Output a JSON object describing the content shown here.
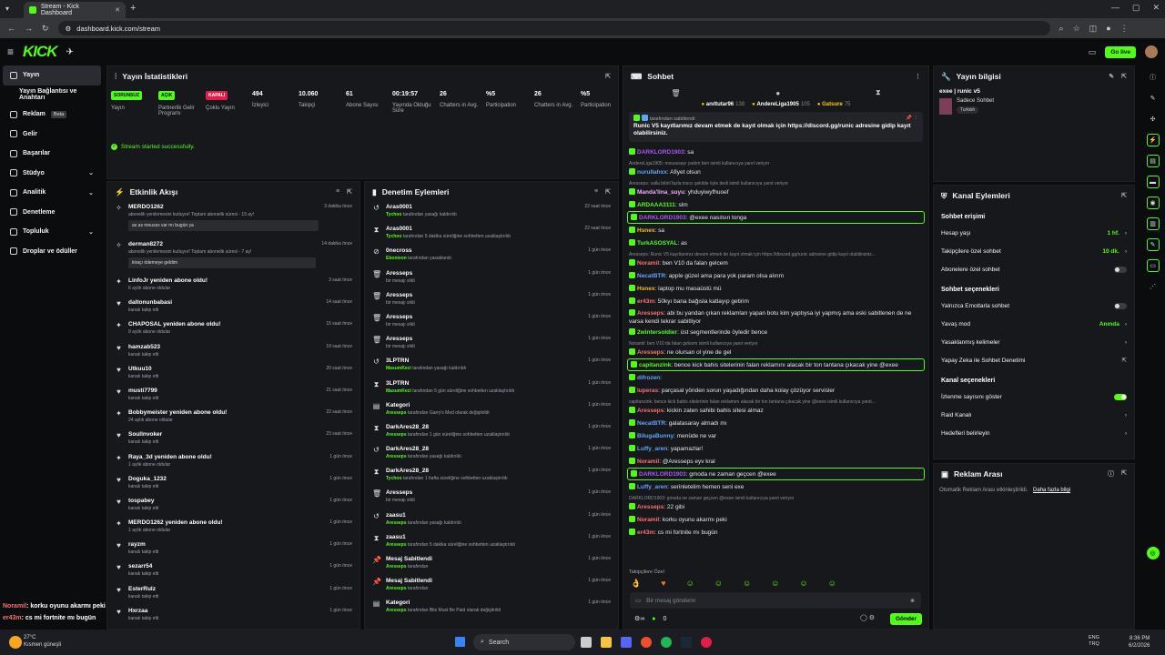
{
  "browser": {
    "tab_title": "Stream - Kick Dashboard",
    "url": "dashboard.kick.com/stream"
  },
  "topbar": {
    "go_live": "Go live"
  },
  "sidebar": {
    "items": [
      {
        "label": "Yayın",
        "icon": "video-icon",
        "active": true
      },
      {
        "label": "Yayın Bağlantısı ve Anahtarı",
        "icon": "",
        "active": false
      },
      {
        "label": "Reklam",
        "icon": "ad-icon",
        "beta": "Beta"
      },
      {
        "label": "Gelir",
        "icon": "money-icon"
      },
      {
        "label": "Başarılar",
        "icon": "trophy-icon"
      },
      {
        "label": "Stüdyo",
        "icon": "studio-icon",
        "chevron": true
      },
      {
        "label": "Analitik",
        "icon": "chart-icon",
        "chevron": true
      },
      {
        "label": "Denetleme",
        "icon": "shield-icon"
      },
      {
        "label": "Topluluk",
        "icon": "community-icon",
        "chevron": true
      },
      {
        "label": "Droplar ve ödüller",
        "icon": "gift-icon"
      }
    ]
  },
  "stats": {
    "title": "Yayın İstatistikleri",
    "success": "Stream started successfully.",
    "cols": [
      {
        "badge": "SORUNSUZ",
        "badge_color": "#53fc18",
        "label": "Yayın"
      },
      {
        "badge": "AÇIK",
        "badge_color": "#53fc18",
        "label": "Partnerlik Gelir Programı"
      },
      {
        "badge": "KAPALI",
        "badge_color": "#e11d48",
        "label": "Çoklu Yayın"
      },
      {
        "value": "494",
        "label": "İzleyici"
      },
      {
        "value": "10.060",
        "label": "Takipçi"
      },
      {
        "value": "61",
        "label": "Abone Sayısı"
      },
      {
        "value": "00:19:57",
        "label": "Yayında Olduğu Süre"
      },
      {
        "value": "26",
        "label": "Chatters in Avg."
      },
      {
        "value": "%5",
        "label": "Participation"
      },
      {
        "value": "26",
        "label": "Chatters in Avg."
      },
      {
        "value": "%5",
        "label": "Participation"
      }
    ]
  },
  "activity": {
    "title": "Etkinlik Akışı",
    "items": [
      {
        "name": "MERDO1262",
        "sub": "abonelik yenilemesini kutluyor! Toplam abonelik süresi - 15 ay!",
        "time": "3 dakika önce",
        "box": "as as mousss var mı bugün ya",
        "icon": "party"
      },
      {
        "name": "derman8272",
        "sub": "abonelik yenilemesini kutluyor! Toplam abonelik süresi - 7 ay!",
        "time": "14 dakika önce",
        "box": "kiraçı ödemeye geldim",
        "icon": "party"
      },
      {
        "name": "LinfoJr yeniden abone oldu!",
        "sub": "6 aylık abone oldular",
        "time": "3 saat önce",
        "icon": "star"
      },
      {
        "name": "daltonunbabasi",
        "sub": "kanalı takip etti",
        "time": "14 saat önce",
        "icon": "heart"
      },
      {
        "name": "CHAPOSAL yeniden abone oldu!",
        "sub": "9 aylık abone oldular",
        "time": "15 saat önce",
        "icon": "star"
      },
      {
        "name": "hamzab523",
        "sub": "kanalı takip etti",
        "time": "19 saat önce",
        "icon": "heart"
      },
      {
        "name": "Utkuu10",
        "sub": "kanalı takip etti",
        "time": "20 saat önce",
        "icon": "heart"
      },
      {
        "name": "musti7799",
        "sub": "kanalı takip etti",
        "time": "21 saat önce",
        "icon": "heart"
      },
      {
        "name": "Bobbymeister yeniden abone oldu!",
        "sub": "24 aylık abone oldular",
        "time": "22 saat önce",
        "icon": "star"
      },
      {
        "name": "Soullnvoker",
        "sub": "kanalı takip etti",
        "time": "23 saat önce",
        "icon": "heart"
      },
      {
        "name": "Raya_3d yeniden abone oldu!",
        "sub": "1 aylık abone oldular",
        "time": "1 gün önce",
        "icon": "star"
      },
      {
        "name": "Doguka_1232",
        "sub": "kanalı takip etti",
        "time": "1 gün önce",
        "icon": "heart"
      },
      {
        "name": "tospabey",
        "sub": "kanalı takip etti",
        "time": "1 gün önce",
        "icon": "heart"
      },
      {
        "name": "MERDO1262 yeniden abone oldu!",
        "sub": "1 aylık abone oldular",
        "time": "1 gün önce",
        "icon": "star"
      },
      {
        "name": "rayzm",
        "sub": "kanalı takip etti",
        "time": "1 gün önce",
        "icon": "heart"
      },
      {
        "name": "sezarr54",
        "sub": "kanalı takip etti",
        "time": "1 gün önce",
        "icon": "heart"
      },
      {
        "name": "EsterRulz",
        "sub": "kanalı takip etti",
        "time": "1 gün önce",
        "icon": "heart"
      },
      {
        "name": "Hxrzaa",
        "sub": "kanalı takip etti",
        "time": "1 gün önce",
        "icon": "heart"
      }
    ]
  },
  "moderation": {
    "title": "Denetim Eylemleri",
    "items": [
      {
        "name": "Aras0001",
        "actor": "Tychoo",
        "sub": "tarafından yasağı kaldırıldı",
        "time": "22 saat önce",
        "icon": "undo"
      },
      {
        "name": "Aras0001",
        "actor": "Tychoo",
        "sub": "tarafından 5 dakika süreliğine sohbetten uzaklaştırıldı",
        "time": "22 saat önce",
        "icon": "timer"
      },
      {
        "name": "0necross",
        "actor": "Ebonivon",
        "sub": "tarafından yasaklandı",
        "time": "1 gün önce",
        "icon": "ban"
      },
      {
        "name": "Aresseps",
        "actor": "",
        "sub": "bir mesajı sildi",
        "time": "1 gün önce",
        "icon": "trash"
      },
      {
        "name": "Aresseps",
        "actor": "",
        "sub": "bir mesajı sildi",
        "time": "1 gün önce",
        "icon": "trash"
      },
      {
        "name": "Aresseps",
        "actor": "",
        "sub": "bir mesajı sildi",
        "time": "1 gün önce",
        "icon": "trash"
      },
      {
        "name": "Aresseps",
        "actor": "",
        "sub": "bir mesajı sildi",
        "time": "1 gün önce",
        "icon": "trash"
      },
      {
        "name": "3LPTRN",
        "actor": "MasumKeci",
        "sub": "tarafından yasağı kaldırıldı",
        "time": "1 gün önce",
        "icon": "undo"
      },
      {
        "name": "3LPTRN",
        "actor": "MasumKeci",
        "sub": "tarafından 5 gün süreliğine sohbetten uzaklaştırıldı",
        "time": "1 gün önce",
        "icon": "timer"
      },
      {
        "name": "Kategori",
        "actor": "Aresseps",
        "sub": "tarafından Garry's Mod olarak değiştirildi",
        "time": "1 gün önce",
        "icon": "doc"
      },
      {
        "name": "DarkAres28_28",
        "actor": "Aresseps",
        "sub": "tarafından 1 gün süreliğine sohbetten uzaklaştırıldı",
        "time": "1 gün önce",
        "icon": "timer"
      },
      {
        "name": "DarkAres28_28",
        "actor": "Aresseps",
        "sub": "tarafından yasağı kaldırıldı",
        "time": "1 gün önce",
        "icon": "undo"
      },
      {
        "name": "DarkAres28_28",
        "actor": "Tychoo",
        "sub": "tarafından 1 hafta süreliğine sohbetten uzaklaştırıldı",
        "time": "1 gün önce",
        "icon": "timer"
      },
      {
        "name": "Aresseps",
        "actor": "",
        "sub": "bir mesajı sildi",
        "time": "1 gün önce",
        "icon": "trash"
      },
      {
        "name": "zaasu1",
        "actor": "Aresseps",
        "sub": "tarafından yasağı kaldırıldı",
        "time": "1 gün önce",
        "icon": "undo"
      },
      {
        "name": "zaasu1",
        "actor": "Aresseps",
        "sub": "tarafından 5 dakika süreliğine sohbetten uzaklaştırıldı",
        "time": "1 gün önce",
        "icon": "timer"
      },
      {
        "name": "Mesaj Sabitlendi",
        "actor": "Aresseps",
        "sub": "tarafından",
        "time": "1 gün önce",
        "icon": "pin"
      },
      {
        "name": "Mesaj Sabitlendi",
        "actor": "Aresseps",
        "sub": "tarafından",
        "time": "1 gün önce",
        "icon": "pin"
      },
      {
        "name": "Kategori",
        "actor": "Aresseps",
        "sub": "tarafından Bits Must Be Paid olarak değiştirildi",
        "time": "1 gün önce",
        "icon": "doc"
      }
    ]
  },
  "chat": {
    "title": "Sohbet",
    "top_gifters": [
      {
        "name": "anıltutar96",
        "n": "138"
      },
      {
        "name": "AndereLiga1905",
        "n": "105"
      },
      {
        "name": "Gatsure",
        "n": "75"
      }
    ],
    "pinned": {
      "by": "tarafından sabitlendi",
      "text": "Runic V5 kayıtlarımız devam etmek de kayıt olmak için https://discord.gg/runic adresine gidip kayıt olabilirsiniz."
    },
    "messages": [
      {
        "u": "DARKLORD1903",
        "uc": "#a855f7",
        "t": "sa"
      },
      {
        "rep": "AndereLiga1905: mousssayı yadım ben isimli kullanıcıya yanıt veriyor"
      },
      {
        "u": "nurullahxx",
        "uc": "#60a5fa",
        "t": "Afiyet olsun"
      },
      {
        "rep": "Aresseps: valla bitiril fazla insıcı şekilde öyle dedi isimli kullanıcıya yanıt veriyor"
      },
      {
        "u": "Manda'lina_suyu",
        "uc": "#f0abfc",
        "t": "yhduyiwyfhuoef"
      },
      {
        "u": "ARDAAA3111",
        "uc": "#53fc18",
        "t": "slm"
      },
      {
        "u": "DARKLORD1903",
        "uc": "#a855f7",
        "t": "@exee nasılsın tonga",
        "hl": true
      },
      {
        "u": "Hsnex",
        "uc": "#fbbf24",
        "t": "sa"
      },
      {
        "u": "TurkASOSYAL",
        "uc": "#53fc18",
        "t": "as"
      },
      {
        "rep": "Aresseps: Runic V5 kayıtlarımız devam etmek de kayıt olmak için https://discord.gg/runic adresine gidip kayıt olabilirsiniz..."
      },
      {
        "u": "Noramil",
        "uc": "#f87171",
        "t": "ben V10 da falan gelcem"
      },
      {
        "u": "NecatBTR",
        "uc": "#60a5fa",
        "t": "apple güzel ama para yok param olsa alırım"
      },
      {
        "u": "Hsnex",
        "uc": "#fbbf24",
        "t": "laptop mu masaüstü mü"
      },
      {
        "u": "er43m",
        "uc": "#f87171",
        "t": "50kyı bana bağısla katlayıp getirim"
      },
      {
        "u": "Aresseps",
        "uc": "#f87171",
        "t": "abi bu yandan çıkan reklamları yapan botu kim yaptıysa iyi yapmış ama eski sabitlenen de ne varsa kendi tekrar sabitliyor",
        "two": true
      },
      {
        "u": "2wintersoldier",
        "uc": "#53fc18",
        "t": "üst segmentlerinde öyledir bence"
      },
      {
        "rep": "Noramil: ben V10 da falan gelcem isimli kullanıcıya yanıt veriyor"
      },
      {
        "u": "Aresseps",
        "uc": "#f87171",
        "t": "ne olursan ol yine de gel"
      },
      {
        "u": "capitanzink",
        "uc": "#53fc18",
        "t": "bence kick bahis sitelerinin falan reklamını alacak bir ton tantana çıkacak yine @exee",
        "hl": true
      },
      {
        "u": "difrozen",
        "uc": "#60a5fa",
        "t": ""
      },
      {
        "u": "luperas",
        "uc": "#f87171",
        "t": "parçasal yönden sorun yaşadığından daha kolay çözüyor servisler"
      },
      {
        "rep": "capitanzink: bence kick bahis sitelerinin falan reklamını alacak bir ton tantana çıkacak yine @exee isimli kullanıcıya yanıt..."
      },
      {
        "u": "Aresseps",
        "uc": "#f87171",
        "t": "kickin zaten sahibi bahis sitesi almaz"
      },
      {
        "u": "NecatBTR",
        "uc": "#60a5fa",
        "t": "galatasaray almadı mı"
      },
      {
        "u": "BilugaBunny",
        "uc": "#60a5fa",
        "t": "menüde ne var"
      },
      {
        "u": "Luffy_aren",
        "uc": "#60a5fa",
        "t": "yapamazlar!"
      },
      {
        "u": "Noramil",
        "uc": "#f87171",
        "t": "@Aresseps eyv kral"
      },
      {
        "u": "DARKLORD1903",
        "uc": "#a855f7",
        "t": "gmoda ne zaman geçcen @exee",
        "hl": true
      },
      {
        "u": "Luffy_aren",
        "uc": "#60a5fa",
        "t": "serinletelim hemen seni exe"
      },
      {
        "rep": "DARKLORD1903: gmoda ne zaman geçcen @exee isimli kullanıcıya yanıt veriyor"
      },
      {
        "u": "Aresseps",
        "uc": "#f87171",
        "t": "22 gibi"
      },
      {
        "u": "Noramil",
        "uc": "#f87171",
        "t": "korku oyunu akarmı peki"
      },
      {
        "u": "er43m",
        "uc": "#f87171",
        "t": "cs mi fortnite mı bugün"
      }
    ],
    "followers_only": "Takipçilere Özel",
    "input_placeholder": "Bir mesaj gönderin",
    "send": "Gönder",
    "count": "0"
  },
  "stream_info": {
    "title": "Yayın bilgisi",
    "stream_title": "exee | runic v5",
    "chat_mode": "Sadece Sohbet",
    "language": "Turkish"
  },
  "channel_actions": {
    "title": "Kanal Eylemleri",
    "chat_access": "Sohbet erişimi",
    "rows1": [
      {
        "label": "Hesap yaşı",
        "value": "1 hf."
      },
      {
        "label": "Takipçilere özel sohbet",
        "value": "10 dk."
      },
      {
        "label": "Abonelere özel sohbet",
        "toggle": false
      }
    ],
    "chat_options": "Sohbet seçenekleri",
    "rows2": [
      {
        "label": "Yalnızca Emotlarla sohbet",
        "toggle": false
      },
      {
        "label": "Yavaş mod",
        "value": "Anında"
      },
      {
        "label": "Yasaklanmış kelimeler"
      },
      {
        "label": "Yapay Zeka ile Sohbet Denetimi",
        "ext": true
      }
    ],
    "channel_options": "Kanal seçenekleri",
    "rows3": [
      {
        "label": "İzlenme sayısını göster",
        "toggle": true
      },
      {
        "label": "Raid Kanalı"
      },
      {
        "label": "Hedefleri belirleyin"
      }
    ]
  },
  "ad_break": {
    "title": "Reklam Arası",
    "text": "Otomatik Reklam Arası etkinleştirildi.",
    "link": "Daha fazla bilgi"
  },
  "overlay": [
    {
      "u": "Noramil",
      "c": "#f87171",
      "t": ": korku oyunu akarmı peki"
    },
    {
      "u": "er43m",
      "c": "#f87171",
      "t": ": cs mi fortnite mı bugün"
    }
  ],
  "taskbar": {
    "temp": "27°C",
    "weather": "Kısmen güneşli",
    "search": "Search",
    "lang1": "ENG",
    "lang2": "TRQ",
    "time": "8:36 PM",
    "date": "6/2/2026"
  }
}
